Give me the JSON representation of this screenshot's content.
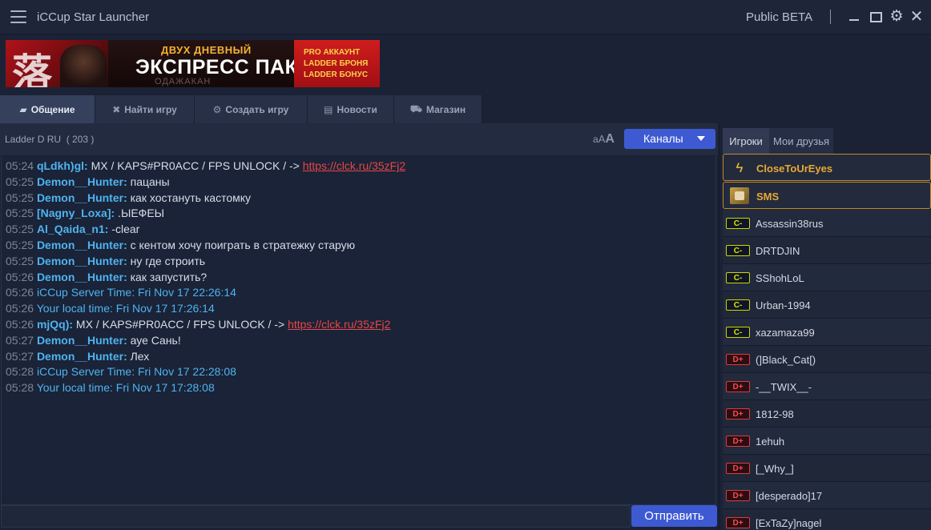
{
  "window": {
    "title": "iCCup Star Launcher",
    "edition": "Public BETA",
    "icons": [
      "menu-icon",
      "minimize-icon",
      "maximize-icon",
      "gear-icon",
      "close-icon"
    ]
  },
  "banner": {
    "line1": "ДВУХ ДНЕВНЫЙ",
    "line2": "ЭКСПРЕСС ПАК",
    "shadow": "ОДАЖАКАН",
    "perks": [
      "PRO АККАУНТ",
      "LADDER БРОНЯ",
      "LADDER БОНУС"
    ],
    "glyph": "落"
  },
  "tabs": [
    {
      "label": "Общение",
      "icon": "chat-icon",
      "active": true
    },
    {
      "label": "Найти игру",
      "icon": "swords-icon",
      "active": false
    },
    {
      "label": "Создать игру",
      "icon": "gears-icon",
      "active": false
    },
    {
      "label": "Новости",
      "icon": "news-icon",
      "active": false
    },
    {
      "label": "Магазин",
      "icon": "cart-icon",
      "active": false
    }
  ],
  "chat": {
    "channel": "Ladder D RU",
    "count": "( 203 )",
    "font_small": "a",
    "font_mid": "A",
    "font_big": "A",
    "channels_button": "Каналы",
    "send_button": "Отправить",
    "input_value": "",
    "messages": [
      {
        "time": "05:24",
        "name": "qLdkh)gl:",
        "text": " MX / KAPS#PR0ACC / FPS UNLOCK / -> ",
        "link": "https://clck.ru/35zFj2"
      },
      {
        "time": "05:25",
        "name": "Demon__Hunter:",
        "text": " пацаны"
      },
      {
        "time": "05:25",
        "name": "Demon__Hunter:",
        "text": " как хостануть кастомку"
      },
      {
        "time": "05:25",
        "name": "[Nagny_Loxa]:",
        "text": " .ЫЕФЕЫ"
      },
      {
        "time": "05:25",
        "name": "Al_Qaida_n1:",
        "text": " -clear"
      },
      {
        "time": "05:25",
        "name": "Demon__Hunter:",
        "text": " с кентом хочу поиграть в стратежку старую"
      },
      {
        "time": "05:25",
        "name": "Demon__Hunter:",
        "text": " ну где строить"
      },
      {
        "time": "05:26",
        "name": "Demon__Hunter:",
        "text": " как запустить?"
      },
      {
        "time": "05:26",
        "system": "iCCup Server Time: Fri Nov 17 22:26:14"
      },
      {
        "time": "05:26",
        "system": "Your local time: Fri Nov 17 17:26:14"
      },
      {
        "time": "05:26",
        "name": "mjQq):",
        "text": " MX / KAPS#PR0ACC / FPS UNLOCK / -> ",
        "link": "https://clck.ru/35zFj2"
      },
      {
        "time": "05:27",
        "name": "Demon__Hunter:",
        "text": " ауе Сань!"
      },
      {
        "time": "05:27",
        "name": "Demon__Hunter:",
        "text": " Лех"
      },
      {
        "time": "05:28",
        "system": "iCCup Server Time: Fri Nov 17 22:28:08"
      },
      {
        "time": "05:28",
        "system": "Your local time: Fri Nov 17 17:28:08"
      }
    ]
  },
  "panel": {
    "tab_players": "Игроки",
    "tab_friends": "Мои друзья",
    "players": [
      {
        "name": "CloseToUrEyes",
        "vip": true,
        "icon": "bolt-icon"
      },
      {
        "name": "SMS",
        "vip": true,
        "icon": "sms-icon"
      },
      {
        "name": "Assassin38rus",
        "rank": "C-"
      },
      {
        "name": "DRTDJIN",
        "rank": "C-"
      },
      {
        "name": "SShohLoL",
        "rank": "C-"
      },
      {
        "name": "Urban-1994",
        "rank": "C-"
      },
      {
        "name": "xazamaza99",
        "rank": "C-"
      },
      {
        "name": "(]Black_Cat[)",
        "rank": "D+"
      },
      {
        "name": "-__TWIX__-",
        "rank": "D+"
      },
      {
        "name": "1812-98",
        "rank": "D+"
      },
      {
        "name": "1ehuh",
        "rank": "D+"
      },
      {
        "name": "[_Why_]",
        "rank": "D+"
      },
      {
        "name": "[desperado]17",
        "rank": "D+"
      },
      {
        "name": "[ExTaZy]nagel",
        "rank": "D+"
      }
    ]
  },
  "colors": {
    "accent": "#3d5ad3",
    "nick": "#4fb3f0",
    "link": "#e84646",
    "vip": "#e8a936",
    "rank_c": "#dce400",
    "rank_d": "#ff4a4a"
  }
}
